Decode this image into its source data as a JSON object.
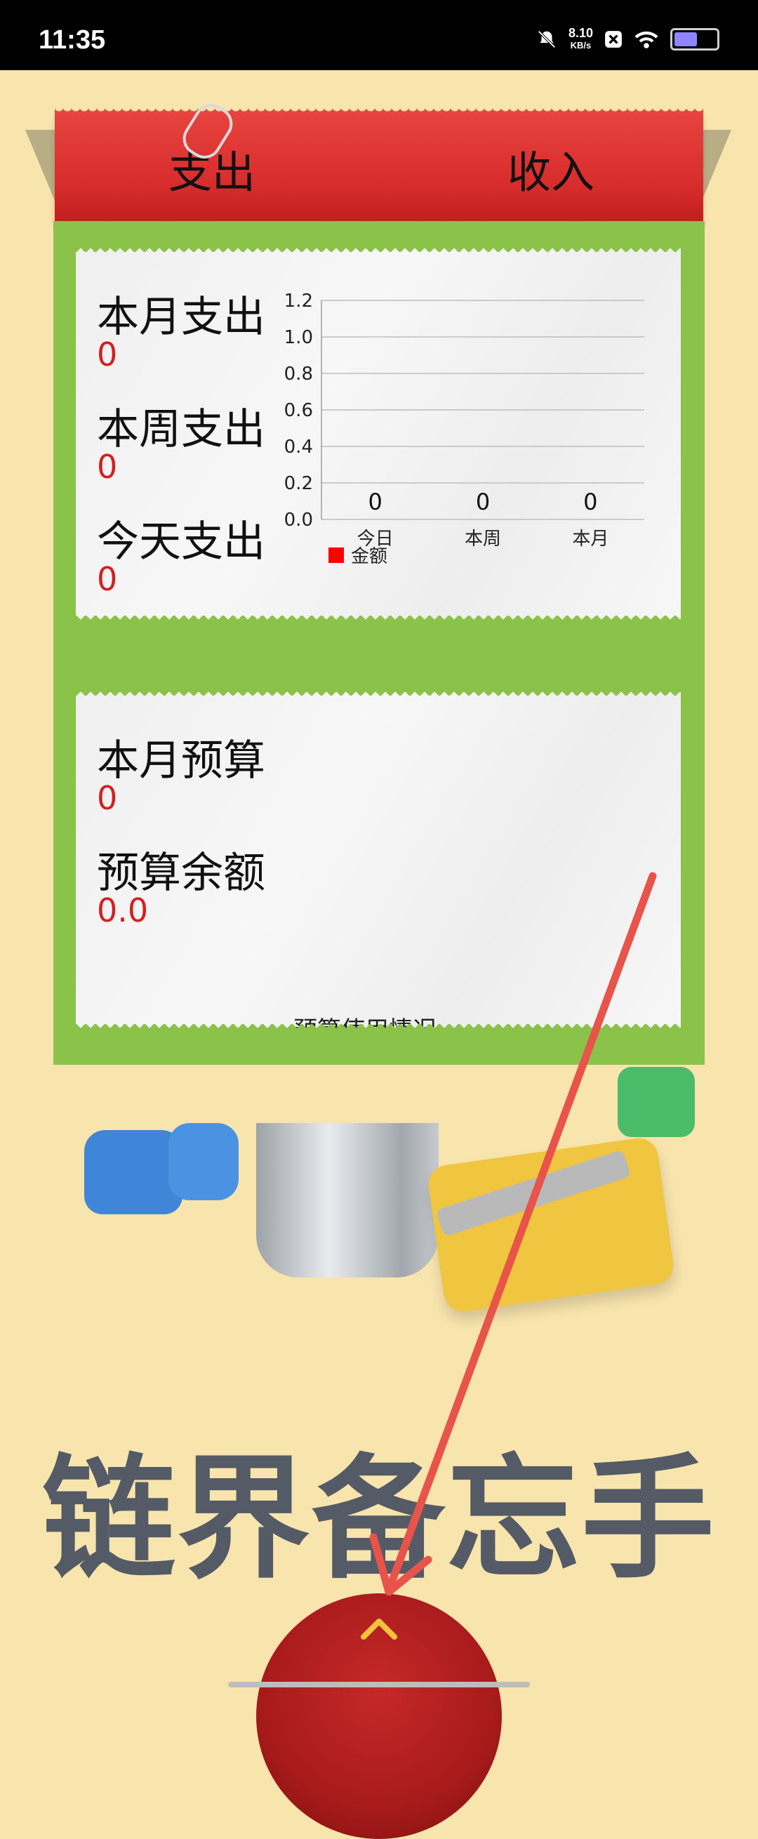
{
  "status_bar": {
    "time": "11:35",
    "net_speed_value": "8.10",
    "net_speed_unit": "KB/s",
    "icons": [
      "bell-muted-icon",
      "x-icon",
      "wifi-icon",
      "battery-icon"
    ]
  },
  "header": {
    "tabs": [
      {
        "label": "支出"
      },
      {
        "label": "收入"
      }
    ]
  },
  "expense_card": {
    "items": [
      {
        "label": "本月支出",
        "value": "0"
      },
      {
        "label": "本周支出",
        "value": "0"
      },
      {
        "label": "今天支出",
        "value": "0"
      }
    ]
  },
  "chart_data": {
    "type": "bar",
    "categories": [
      "今日",
      "本周",
      "本月"
    ],
    "series": [
      {
        "name": "金额",
        "values": [
          0,
          0,
          0
        ]
      }
    ],
    "data_labels": [
      "0",
      "0",
      "0"
    ],
    "yticks": [
      "0.0",
      "0.2",
      "0.4",
      "0.6",
      "0.8",
      "1.0",
      "1.2"
    ],
    "ylim": [
      0,
      1.2
    ],
    "grid": true,
    "legend": "bottom-left",
    "colors": {
      "series": "#ff0000"
    }
  },
  "budget_card": {
    "items": [
      {
        "label": "本月预算",
        "value": "0"
      },
      {
        "label": "预算余额",
        "value": "0.0"
      }
    ],
    "cutoff_text": "预算使用情况"
  },
  "app_title": "链界备忘手记",
  "colors": {
    "background": "#f8e4ad",
    "header_red": "#d62b2b",
    "panel_green": "#8bc34a",
    "value_red": "#d32020",
    "title_gray": "#545b66",
    "annotation_arrow": "#e8534a"
  }
}
